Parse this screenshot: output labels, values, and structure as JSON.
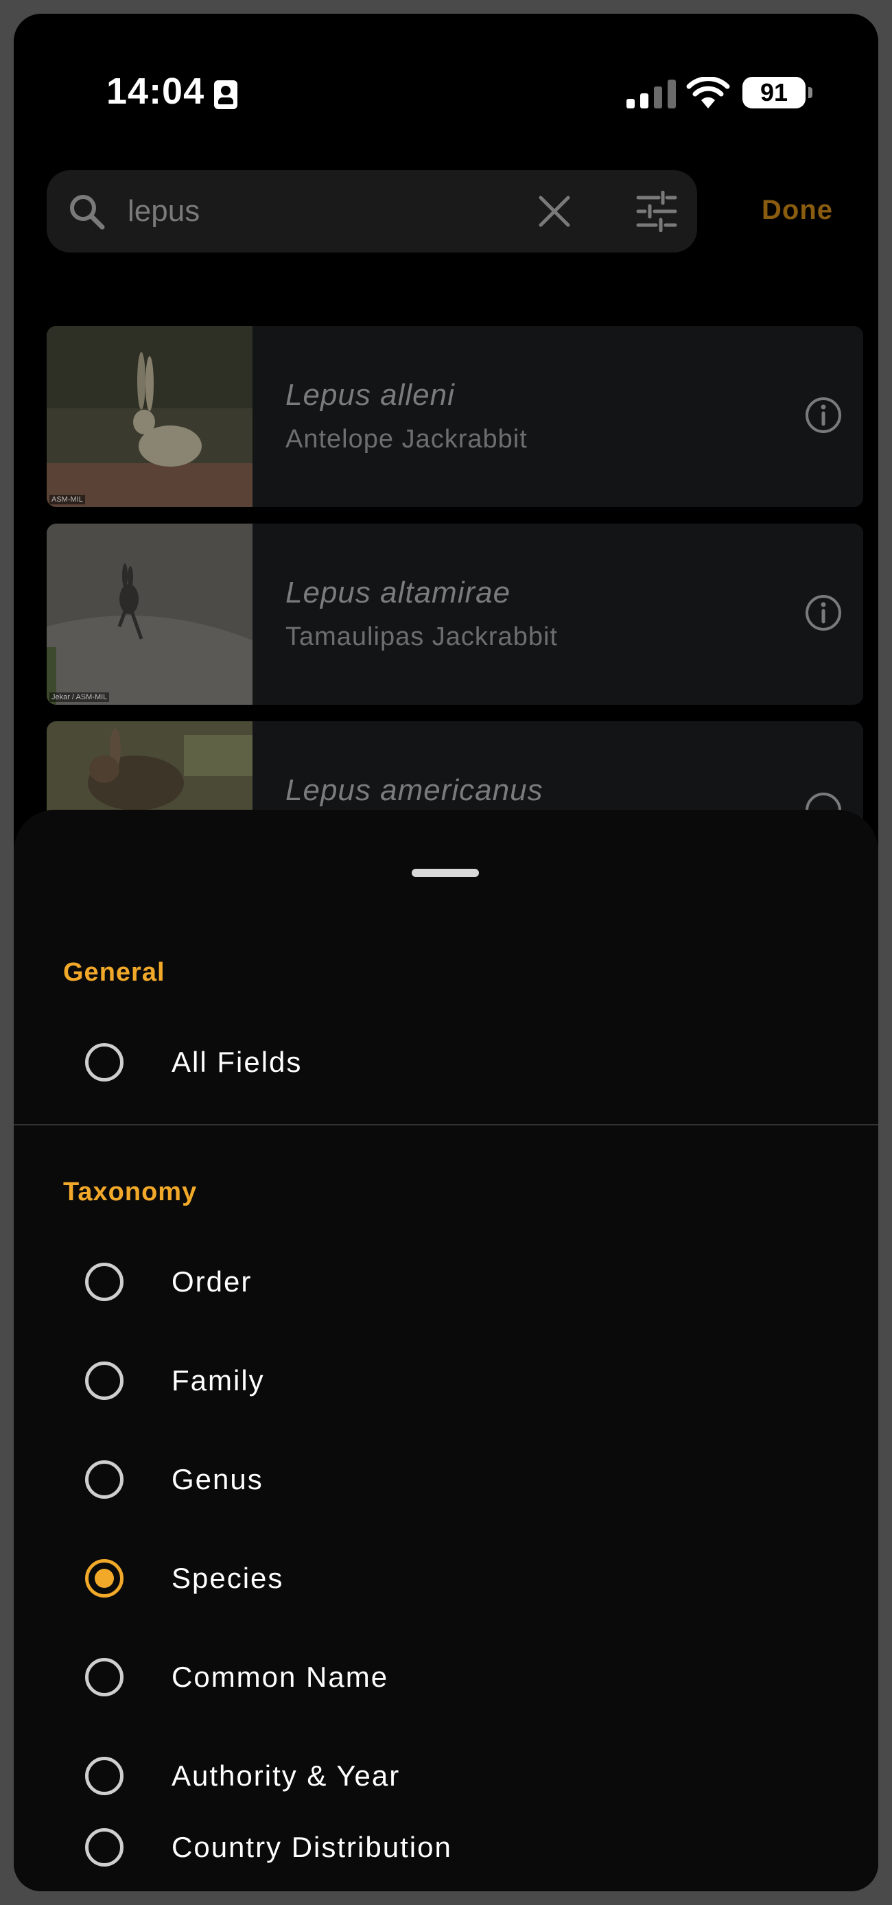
{
  "status_bar": {
    "time": "14:04",
    "battery": "91"
  },
  "search": {
    "value": "lepus",
    "done_label": "Done"
  },
  "results": [
    {
      "scientific_name": "Lepus alleni",
      "common_name": "Antelope Jackrabbit",
      "credit": "ASM-MIL"
    },
    {
      "scientific_name": "Lepus altamirae",
      "common_name": "Tamaulipas Jackrabbit",
      "credit": "Jekar / ASM-MIL"
    },
    {
      "scientific_name": "Lepus americanus",
      "common_name": "",
      "credit": ""
    }
  ],
  "sheet": {
    "general": {
      "title": "General",
      "options": [
        {
          "label": "All Fields",
          "selected": false
        }
      ]
    },
    "taxonomy": {
      "title": "Taxonomy",
      "options": [
        {
          "label": "Order",
          "selected": false
        },
        {
          "label": "Family",
          "selected": false
        },
        {
          "label": "Genus",
          "selected": false
        },
        {
          "label": "Species",
          "selected": true
        },
        {
          "label": "Common Name",
          "selected": false
        },
        {
          "label": "Authority & Year",
          "selected": false
        },
        {
          "label": "Country Distribution",
          "selected": false
        }
      ]
    }
  },
  "colors": {
    "accent": "#f2a92a",
    "done_dimmed": "#8a5c10",
    "card_bg": "#121416",
    "sheet_bg": "#0a0a0a"
  }
}
